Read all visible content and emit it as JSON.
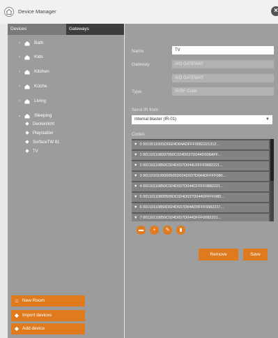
{
  "app": {
    "title": "Device Manager"
  },
  "tabs": {
    "devices": "Devices",
    "gateways": "Gateways"
  },
  "tree": {
    "rooms": [
      "Bath",
      "Kids",
      "Kitchen",
      "Küche",
      "Living",
      "Sleeping"
    ],
    "devices": [
      "Deckenlicht",
      "Playstation",
      "SurfaceTW 81",
      "TV"
    ]
  },
  "sidebar_buttons": {
    "new_room": "New Room",
    "import_devices": "Import devices",
    "add_device": "Add device"
  },
  "form": {
    "name_label": "Name",
    "name_value": "TV",
    "gateway_label": "Gateway",
    "gateway_value_1": "AIO GATEWAY",
    "gateway_value_2": "AIO GATEWAY",
    "type_label": "Type",
    "type_value": "IR/RF Code",
    "send_ir_label": "Send IR from",
    "send_ir_value": "Internal blaster (IR-01)",
    "codes_label": "Codes"
  },
  "codes": [
    {
      "index": "0",
      "value": "001001160SD0024D84ADFFF0082221312..."
    },
    {
      "index": "1",
      "value": "001101108007050C024D037D044D008AFF..."
    },
    {
      "index": "2",
      "value": "00110110850C024D037D044LFFFF0882221..."
    },
    {
      "index": "3",
      "value": "0011010109000505D024D037D044DFFFF080..."
    },
    {
      "index": "4",
      "value": "00110110850C024D037D044CFFFF0882221..."
    },
    {
      "index": "5",
      "value": "00110110800505DC024D037D044DFFFF080..."
    },
    {
      "index": "6",
      "value": "00110110850D024D037D84AD0FFF0082227..."
    },
    {
      "index": "7",
      "value": "00110110850C024D037D044DFFF0082221..."
    }
  ],
  "actions": {
    "remove": "Remove",
    "save": "Save"
  },
  "colors": {
    "accent": "#e07a1f",
    "sidebar": "#9c9c9c",
    "panel": "#9e9e9e"
  },
  "icons": {
    "close": "×",
    "diamond": "◆",
    "caret": "›",
    "pin": "▼"
  }
}
